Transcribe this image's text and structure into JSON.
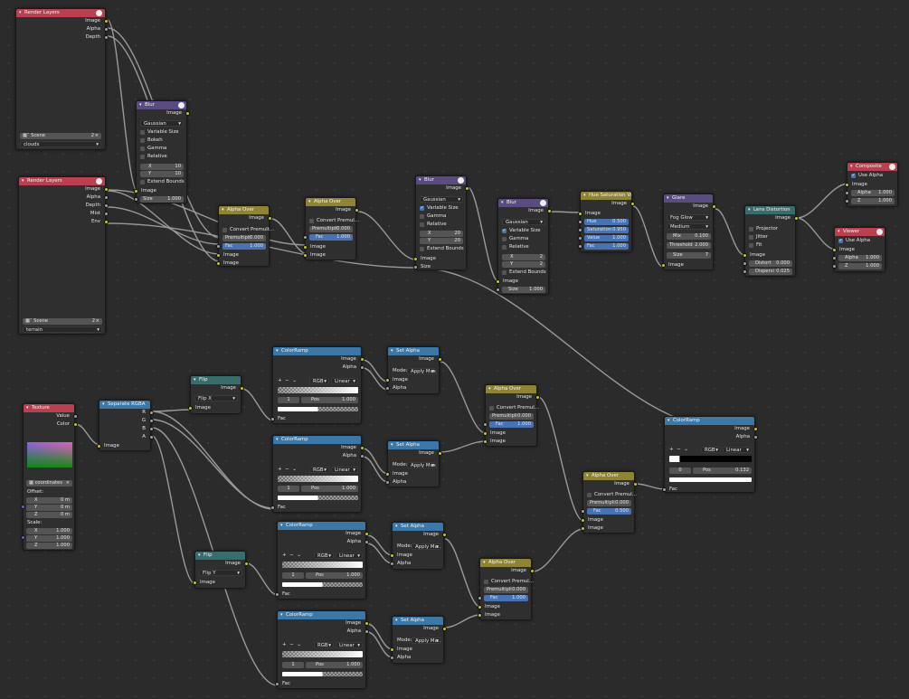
{
  "nodes": {
    "rl1": {
      "title": "Render Layers",
      "outs": [
        "Image",
        "Alpha",
        "Depth"
      ],
      "scene": "Scene",
      "scene_num": "2",
      "layer": "clouds"
    },
    "rl2": {
      "title": "Render Layers",
      "outs": [
        "Image",
        "Alpha",
        "Depth",
        "Mist",
        "Env"
      ],
      "scene": "Scene",
      "scene_num": "2",
      "layer": "terrain"
    },
    "blur1": {
      "title": "Blur",
      "out": "Image",
      "mode": "Gaussian",
      "checks": [
        "Variable Size",
        "Bokeh",
        "Gamma",
        "Relative"
      ],
      "x": "X",
      "xv": "10",
      "y": "Y",
      "yv": "10",
      "ext": "Extend Bounds",
      "in": "Image",
      "size": "Size",
      "sizev": "1.000"
    },
    "ao1": {
      "title": "Alpha Over",
      "out": "Image",
      "conv": "Convert Premult...",
      "premul": "Premultipli",
      "premulv": "0.000",
      "fac": "Fac",
      "facv": "1.000",
      "in1": "Image",
      "in2": "Image"
    },
    "ao2": {
      "title": "Alpha Over",
      "out": "Image",
      "conv": "Convert Premul...",
      "premul": "Premultipli",
      "premulv": "0.000",
      "fac": "Fac",
      "facv": "1.000",
      "in1": "Image",
      "in2": "Image"
    },
    "blur2": {
      "title": "Blur",
      "out": "Image",
      "mode": "Gaussian",
      "checks": [
        "Variable Size",
        "Gamma",
        "Relative"
      ],
      "x": "X",
      "xv": "20",
      "y": "Y",
      "yv": "20",
      "ext": "Extend Bounds",
      "in": "Image",
      "size": "Size"
    },
    "blur3": {
      "title": "Blur",
      "out": "Image",
      "mode": "Gaussian",
      "checks": [
        "Variable Size",
        "Gamma",
        "Relative"
      ],
      "x": "X",
      "xv": "2",
      "y": "Y",
      "yv": "2",
      "ext": "Extend Bounds",
      "in": "Image",
      "size": "Size",
      "sizev": "1.000"
    },
    "hsv": {
      "title": "Hue Saturation Val...",
      "out": "Image",
      "in": "Image",
      "hue": "Hue",
      "huev": "0.500",
      "sat": "Saturation",
      "satv": "0.950",
      "val": "Value",
      "valv": "1.000",
      "fac": "Fac",
      "facv": "1.000"
    },
    "glare": {
      "title": "Glare",
      "out": "Image",
      "type": "Fog Glow",
      "quality": "Medium",
      "mix": "Mix",
      "mixv": "0.100",
      "thr": "Threshold",
      "thrv": "2.000",
      "size": "Size",
      "sizev": "7",
      "in": "Image"
    },
    "lens": {
      "title": "Lens Distortion",
      "out": "Image",
      "checks": [
        "Projector",
        "Jitter",
        "Fit"
      ],
      "in": "Image",
      "dist": "Distort",
      "distv": "0.000",
      "disp": "Dispersi",
      "dispv": "0.025"
    },
    "comp": {
      "title": "Composite",
      "use": "Use Alpha",
      "in": "Image",
      "a": "Alpha",
      "av": "1.000",
      "z": "Z",
      "zv": "1.000"
    },
    "view": {
      "title": "Viewer",
      "use": "Use Alpha",
      "in": "Image",
      "a": "Alpha",
      "av": "1.000",
      "z": "Z",
      "zv": "1.000"
    },
    "tex": {
      "title": "Texture",
      "outs": [
        "Value",
        "Color"
      ],
      "tex": "coordinates",
      "offset": "Offset:",
      "ox": "0 m",
      "oy": "0 m",
      "oz": "0 m",
      "scale": "Scale:",
      "sx": "1.000",
      "sy": "1.000",
      "sz": "1.000",
      "X": "X",
      "Y": "Y",
      "Z": "Z"
    },
    "sep": {
      "title": "Separate RGBA",
      "outs": [
        "R",
        "G",
        "B",
        "A"
      ],
      "in": "Image"
    },
    "flipx": {
      "title": "Flip",
      "out": "Image",
      "mode": "Flip X",
      "in": "Image"
    },
    "flipy": {
      "title": "Flip",
      "out": "Image",
      "mode": "Flip Y",
      "in": "Image"
    },
    "cr1": {
      "title": "ColorRamp",
      "outs": [
        "Image",
        "Alpha"
      ],
      "rgb": "RGB",
      "interp": "Linear",
      "idx": "1",
      "pos": "Pos",
      "posv": "1.000",
      "in": "Fac"
    },
    "cr2": {
      "title": "ColorRamp",
      "outs": [
        "Image",
        "Alpha"
      ],
      "rgb": "RGB",
      "interp": "Linear",
      "idx": "1",
      "pos": "Pos",
      "posv": "1.000",
      "in": "Fac"
    },
    "cr3": {
      "title": "ColorRamp",
      "outs": [
        "Image",
        "Alpha"
      ],
      "rgb": "RGB",
      "interp": "Linear",
      "idx": "1",
      "pos": "Pos",
      "posv": "1.000",
      "in": "Fac"
    },
    "cr4": {
      "title": "ColorRamp",
      "outs": [
        "Image",
        "Alpha"
      ],
      "rgb": "RGB",
      "interp": "Linear",
      "idx": "1",
      "pos": "Pos",
      "posv": "1.000",
      "in": "Fac"
    },
    "cr5": {
      "title": "ColorRamp",
      "outs": [
        "Image",
        "Alpha"
      ],
      "rgb": "RGB",
      "interp": "Linear",
      "idx": "0",
      "pos": "Pos",
      "posv": "0.132",
      "in": "Fac"
    },
    "sa1": {
      "title": "Set Alpha",
      "out": "Image",
      "mode": "Mode:",
      "modev": "Apply Mas",
      "in1": "Image",
      "in2": "Alpha"
    },
    "sa2": {
      "title": "Set Alpha",
      "out": "Image",
      "mode": "Mode:",
      "modev": "Apply Mas",
      "in1": "Image",
      "in2": "Alpha"
    },
    "sa3": {
      "title": "Set Alpha",
      "out": "Image",
      "mode": "Mode:",
      "modev": "Apply Ma...",
      "in1": "Image",
      "in2": "Alpha"
    },
    "sa4": {
      "title": "Set Alpha",
      "out": "Image",
      "mode": "Mode:",
      "modev": "Apply Ma...",
      "in1": "Image",
      "in2": "Alpha"
    },
    "ao3": {
      "title": "Alpha Over",
      "out": "Image",
      "conv": "Convert Premul...",
      "premul": "Premultipli",
      "premulv": "0.000",
      "fac": "Fac",
      "facv": "1.000",
      "in1": "Image",
      "in2": "Image"
    },
    "ao4": {
      "title": "Alpha Over",
      "out": "Image",
      "conv": "Convert Premul...",
      "premul": "Premultipli",
      "premulv": "0.000",
      "fac": "Fac",
      "facv": "0.500",
      "in1": "Image",
      "in2": "Image"
    },
    "ao5": {
      "title": "Alpha Over",
      "out": "Image",
      "conv": "Convert Premul...",
      "premul": "Premultipli",
      "premulv": "0.000",
      "fac": "Fac",
      "facv": "1.000",
      "in1": "Image",
      "in2": "Image"
    }
  },
  "ramp_tools": {
    "add": "+",
    "remove": "−",
    "menu": "⌄"
  },
  "colors": {
    "background": "#2b2b2b",
    "image_socket": "#c7c729",
    "float_socket": "#a1a1a1",
    "vector_socket": "#6363c7",
    "wire": "#9a9a9a",
    "selected_field": "#4772b3"
  }
}
